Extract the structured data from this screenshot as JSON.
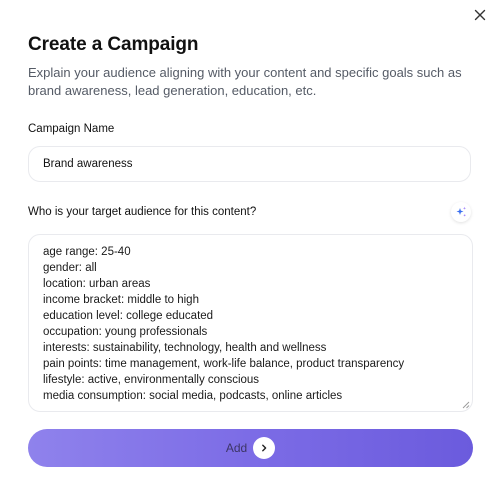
{
  "modal": {
    "title": "Create a Campaign",
    "subtitle": "Explain your audience aligning with your content and specific goals such as brand awareness, lead generation, education, etc."
  },
  "campaign_name": {
    "label": "Campaign Name",
    "value": "Brand awareness"
  },
  "audience": {
    "label": "Who is your target audience for this content?",
    "lines": [
      "age range: 25-40",
      "gender: all",
      "location: urban areas",
      "income bracket: middle to high",
      "education level: college educated",
      "occupation: young professionals",
      "interests: sustainability, technology, health and wellness",
      "pain points: time management, work-life balance, product transparency",
      "lifestyle: active, environmentally conscious",
      "media consumption: social media, podcasts, online articles"
    ]
  },
  "add_button": {
    "label": "Add"
  },
  "icons": {
    "close": "close-icon",
    "sparkle": "sparkle-icon",
    "arrow": "chevron-right-icon"
  },
  "colors": {
    "button_gradient_start": "#8f82ec",
    "button_gradient_end": "#6b5bdd",
    "sparkle_blue": "#3b6ff0",
    "subtitle_text": "#555b66"
  }
}
